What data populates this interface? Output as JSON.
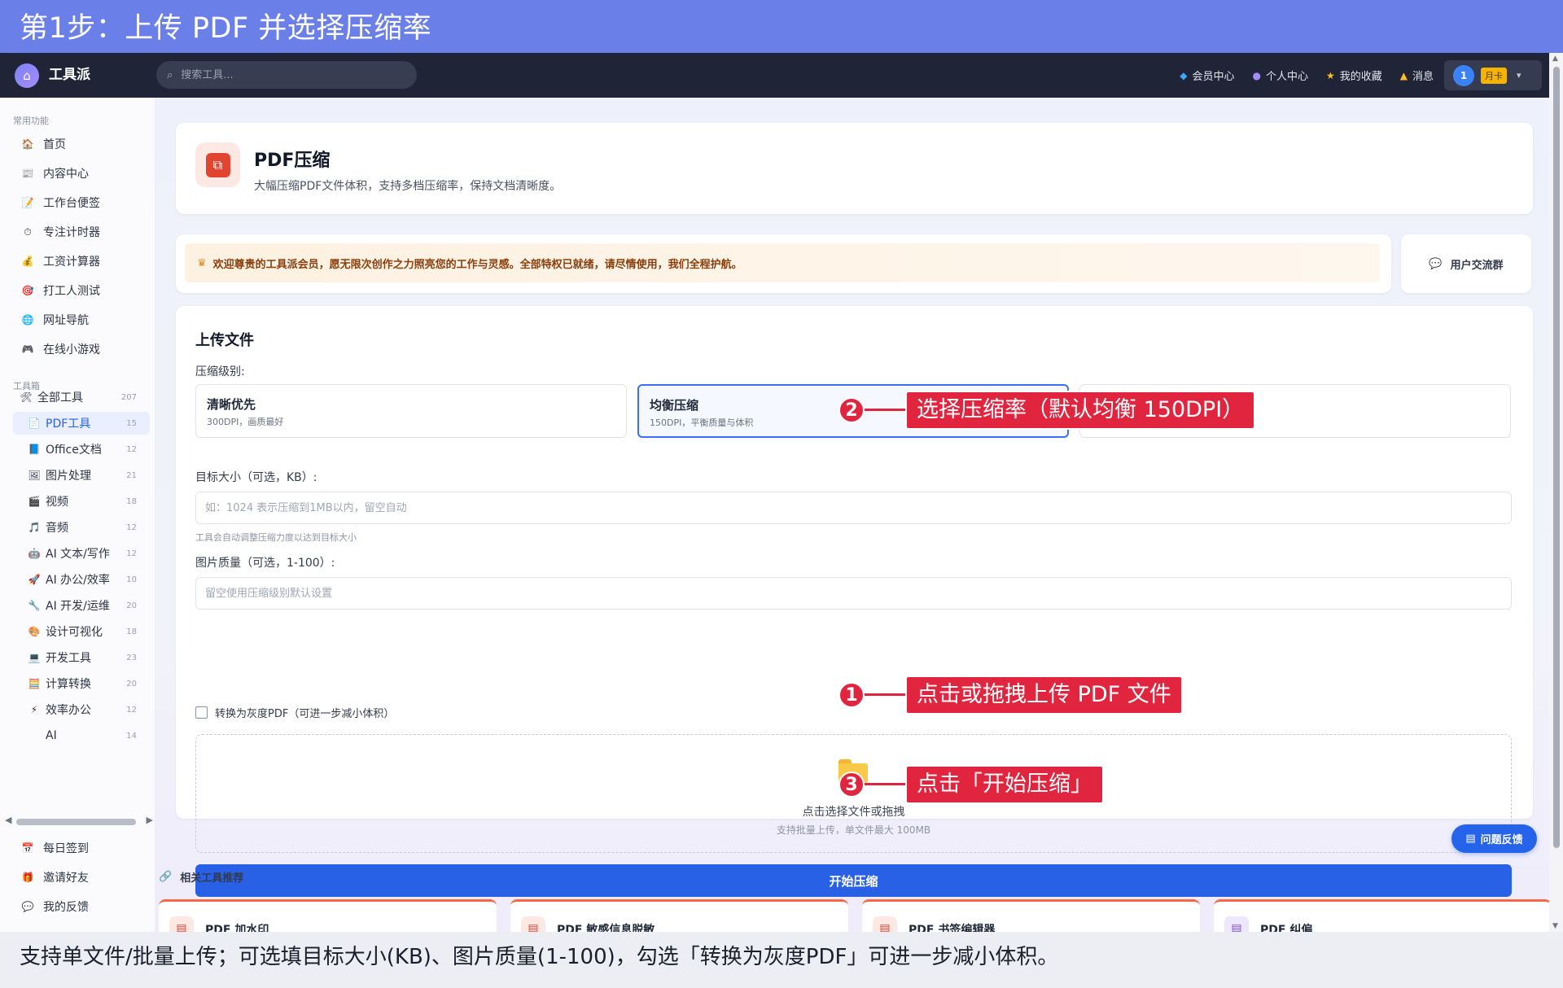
{
  "banner": {
    "title": "第1步：上传 PDF 并选择压缩率"
  },
  "caption": {
    "text": "支持单文件/批量上传；可选填目标大小(KB)、图片质量(1-100)，勾选「转换为灰度PDF」可进一步减小体积。"
  },
  "topnav": {
    "brand": "工具派",
    "search_placeholder": "搜索工具...",
    "links": [
      {
        "icon": "diamond-icon",
        "label": "会员中心"
      },
      {
        "icon": "user-icon",
        "label": "个人中心"
      },
      {
        "icon": "star-icon",
        "label": "我的收藏"
      },
      {
        "icon": "bell-icon",
        "label": "消息"
      }
    ],
    "user": {
      "avatar": "1",
      "badge": "月卡"
    }
  },
  "sidebar": {
    "common_title": "常用功能",
    "common": [
      {
        "icon": "home-icon",
        "glyph": "🏠",
        "label": "首页"
      },
      {
        "icon": "content-icon",
        "glyph": "📰",
        "label": "内容中心"
      },
      {
        "icon": "note-icon",
        "glyph": "📝",
        "label": "工作台便签"
      },
      {
        "icon": "timer-icon",
        "glyph": "⏱",
        "label": "专注计时器"
      },
      {
        "icon": "money-icon",
        "glyph": "💰",
        "label": "工资计算器"
      },
      {
        "icon": "target-icon",
        "glyph": "🎯",
        "label": "打工人测试"
      },
      {
        "icon": "globe-icon",
        "glyph": "🌐",
        "label": "网址导航"
      },
      {
        "icon": "gamepad-icon",
        "glyph": "🎮",
        "label": "在线小游戏"
      }
    ],
    "toolbox_title": "工具箱",
    "tools": [
      {
        "icon": "tools-icon",
        "glyph": "🛠",
        "label": "全部工具",
        "count": "207",
        "kind": "all"
      },
      {
        "icon": "pdf-icon",
        "glyph": "📄",
        "label": "PDF工具",
        "count": "15",
        "kind": "active"
      },
      {
        "icon": "office-icon",
        "glyph": "📘",
        "label": "Office文档",
        "count": "12",
        "kind": ""
      },
      {
        "icon": "image-icon",
        "glyph": "🖼",
        "label": "图片处理",
        "count": "21",
        "kind": ""
      },
      {
        "icon": "video-icon",
        "glyph": "🎬",
        "label": "视频",
        "count": "18",
        "kind": ""
      },
      {
        "icon": "music-icon",
        "glyph": "🎵",
        "label": "音频",
        "count": "12",
        "kind": ""
      },
      {
        "icon": "ai-writing-icon",
        "glyph": "🤖",
        "label": "AI 文本/写作",
        "count": "12",
        "kind": ""
      },
      {
        "icon": "ai-office-icon",
        "glyph": "🚀",
        "label": "AI 办公/效率",
        "count": "10",
        "kind": ""
      },
      {
        "icon": "wrench-icon",
        "glyph": "🔧",
        "label": "AI 开发/运维",
        "count": "20",
        "kind": ""
      },
      {
        "icon": "palette-icon",
        "glyph": "🎨",
        "label": "设计可视化",
        "count": "18",
        "kind": ""
      },
      {
        "icon": "monitor-icon",
        "glyph": "💻",
        "label": "开发工具",
        "count": "23",
        "kind": ""
      },
      {
        "icon": "calculator-icon",
        "glyph": "🧮",
        "label": "计算转换",
        "count": "20",
        "kind": ""
      },
      {
        "icon": "bolt-icon",
        "glyph": "⚡",
        "label": "效率办公",
        "count": "12",
        "kind": ""
      },
      {
        "icon": "",
        "glyph": "",
        "label": "AI",
        "count": "14",
        "kind": "ai"
      }
    ],
    "bottom": [
      {
        "icon": "calendar-icon",
        "glyph": "📅",
        "label": "每日签到"
      },
      {
        "icon": "gift-icon",
        "glyph": "🎁",
        "label": "邀请好友"
      },
      {
        "icon": "chat-icon",
        "glyph": "💬",
        "label": "我的反馈"
      }
    ]
  },
  "header": {
    "icon": "pdf-compress-icon",
    "title": "PDF压缩",
    "desc": "大幅压缩PDF文件体积，支持多档压缩率，保持文档清晰度。"
  },
  "welcome": {
    "text": "欢迎尊贵的工具派会员，愿无限次创作之力照亮您的工作与灵感。全部特权已就绪，请尽情使用，我们全程护航。",
    "group_label": "用户交流群"
  },
  "form": {
    "title": "上传文件",
    "level_label": "压缩级别:",
    "levels": [
      {
        "name": "清晰优先",
        "desc": "300DPI，画质最好",
        "selected": false
      },
      {
        "name": "均衡压缩",
        "desc": "150DPI，平衡质量与体积",
        "selected": true
      },
      {
        "name": "",
        "desc": "",
        "selected": false
      }
    ],
    "target_label": "目标大小（可选，KB）:",
    "target_placeholder": "如：1024 表示压缩到1MB以内，留空自动",
    "target_hint": "工具会自动调整压缩力度以达到目标大小",
    "quality_label": "图片质量（可选，1-100）:",
    "quality_placeholder": "留空使用压缩级别默认设置",
    "grayscale_label": "转换为灰度PDF（可进一步减小体积）",
    "grayscale_checked": false,
    "drop_text": "点击选择文件或拖拽",
    "drop_sub": "支持批量上传，单文件最大 100MB",
    "start_label": "开始压缩"
  },
  "feedback_label": "问题反馈",
  "related": {
    "title": "相关工具推荐",
    "items": [
      {
        "label": "PDF 加水印",
        "glyph": "📄"
      },
      {
        "label": "PDF 敏感信息脱敏",
        "glyph": "📄"
      },
      {
        "label": "PDF 书签编辑器",
        "glyph": "📄"
      },
      {
        "label": "PDF 纠偏",
        "glyph": "📄"
      }
    ]
  },
  "annotations": [
    {
      "num": "1",
      "text": "点击或拖拽上传 PDF 文件"
    },
    {
      "num": "2",
      "text": "选择压缩率（默认均衡 150DPI）"
    },
    {
      "num": "3",
      "text": "点击「开始压缩」"
    }
  ],
  "colors": {
    "banner": "#6b7fe8",
    "accent": "#2860e6",
    "annotation": "#e1253f",
    "nav": "#1f2437"
  }
}
